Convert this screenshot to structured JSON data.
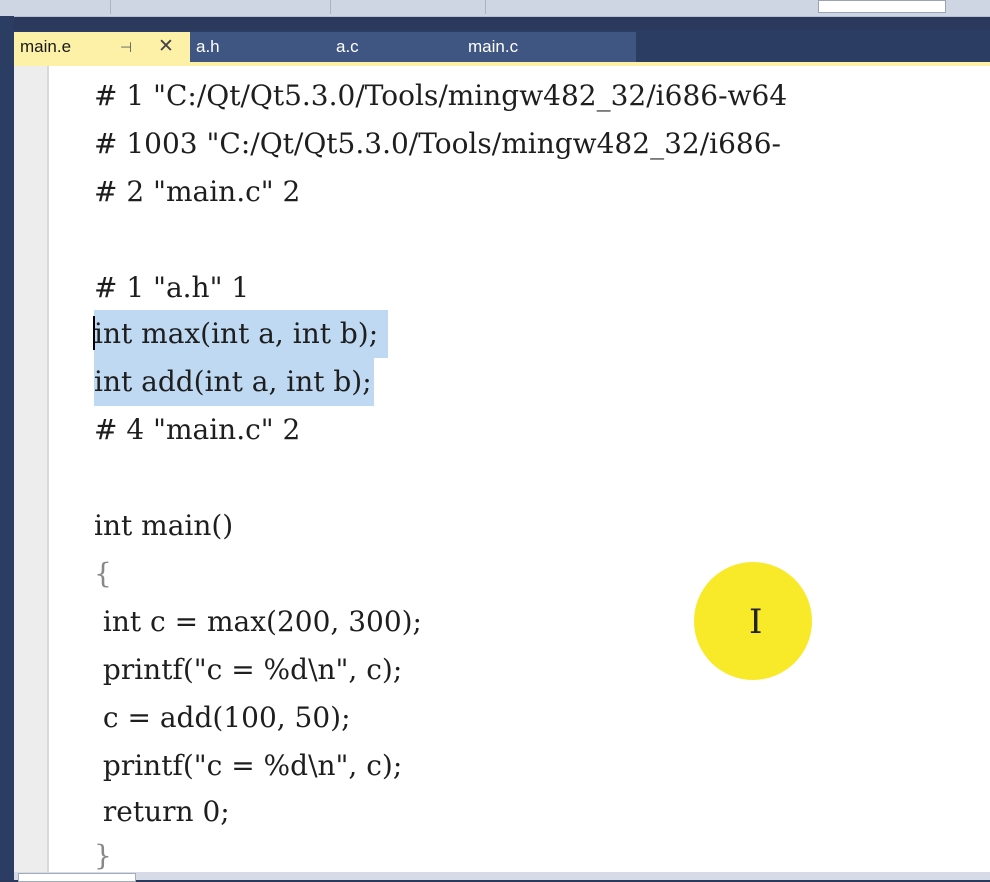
{
  "tabs": [
    {
      "label": "main.e",
      "active": true
    },
    {
      "label": "a.h",
      "active": false
    },
    {
      "label": "a.c",
      "active": false
    },
    {
      "label": "main.c",
      "active": false
    }
  ],
  "tab_icons": {
    "pin": "⊣",
    "close": "✕"
  },
  "code": {
    "lines": [
      "# 1 \"C:/Qt/Qt5.3.0/Tools/mingw482_32/i686-w64",
      "# 1003 \"C:/Qt/Qt5.3.0/Tools/mingw482_32/i686-",
      "# 2 \"main.c\" 2",
      "",
      "# 1 \"a.h\" 1",
      "int max(int a, int b);",
      "int add(int a, int b);",
      "# 4 \"main.c\" 2",
      "",
      "int main()",
      "{",
      " int c = max(200, 300);",
      " printf(\"c = %d\\n\", c);",
      " c = add(100, 50);",
      " printf(\"c = %d\\n\", c);",
      " return 0;",
      "}"
    ]
  },
  "colors": {
    "active_tab": "#fdf1a7",
    "selection": "#bfd9f2",
    "cursor_highlight": "#f7e817",
    "frame": "#2c3d63"
  },
  "icons": {
    "cursor": "ibeam-cursor-icon"
  }
}
